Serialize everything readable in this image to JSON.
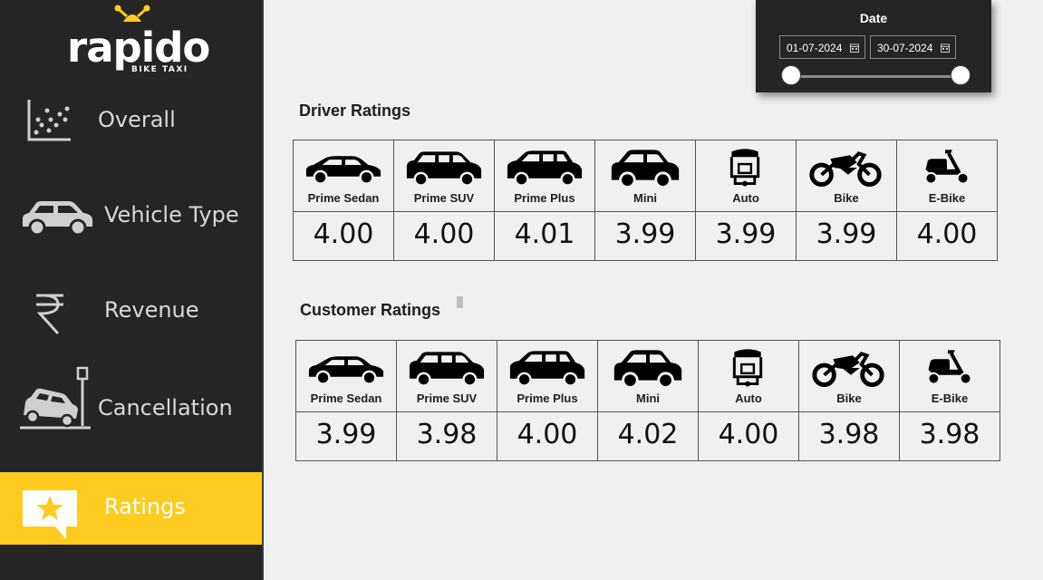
{
  "brand": {
    "name": "rapido",
    "tagline": "BIKE TAXI",
    "accent": "#fecc20"
  },
  "sidebar": {
    "items": [
      {
        "label": "Overall",
        "icon": "scatter-chart-icon"
      },
      {
        "label": "Vehicle Type",
        "icon": "car-icon"
      },
      {
        "label": "Revenue",
        "icon": "rupee-icon"
      },
      {
        "label": "Cancellation",
        "icon": "car-crash-icon"
      },
      {
        "label": "Ratings",
        "icon": "star-speech-bubble-icon",
        "active": true
      }
    ]
  },
  "date_filter": {
    "title": "Date",
    "start": "01-07-2024",
    "end": "30-07-2024"
  },
  "driver_ratings": {
    "title": "Driver Ratings",
    "items": [
      {
        "label": "Prime Sedan",
        "value": "4.00",
        "icon": "sedan-icon"
      },
      {
        "label": "Prime SUV",
        "value": "4.00",
        "icon": "suv-icon"
      },
      {
        "label": "Prime Plus",
        "value": "4.01",
        "icon": "hatchback-icon"
      },
      {
        "label": "Mini",
        "value": "3.99",
        "icon": "mini-car-icon"
      },
      {
        "label": "Auto",
        "value": "3.99",
        "icon": "auto-rickshaw-icon"
      },
      {
        "label": "Bike",
        "value": "3.99",
        "icon": "motorbike-icon"
      },
      {
        "label": "E-Bike",
        "value": "4.00",
        "icon": "scooter-icon"
      }
    ]
  },
  "customer_ratings": {
    "title": "Customer Ratings",
    "items": [
      {
        "label": "Prime Sedan",
        "value": "3.99",
        "icon": "sedan-icon"
      },
      {
        "label": "Prime SUV",
        "value": "3.98",
        "icon": "suv-icon"
      },
      {
        "label": "Prime Plus",
        "value": "4.00",
        "icon": "hatchback-icon"
      },
      {
        "label": "Mini",
        "value": "4.02",
        "icon": "mini-car-icon"
      },
      {
        "label": "Auto",
        "value": "4.00",
        "icon": "auto-rickshaw-icon"
      },
      {
        "label": "Bike",
        "value": "3.98",
        "icon": "motorbike-icon"
      },
      {
        "label": "E-Bike",
        "value": "3.98",
        "icon": "scooter-icon"
      }
    ]
  }
}
